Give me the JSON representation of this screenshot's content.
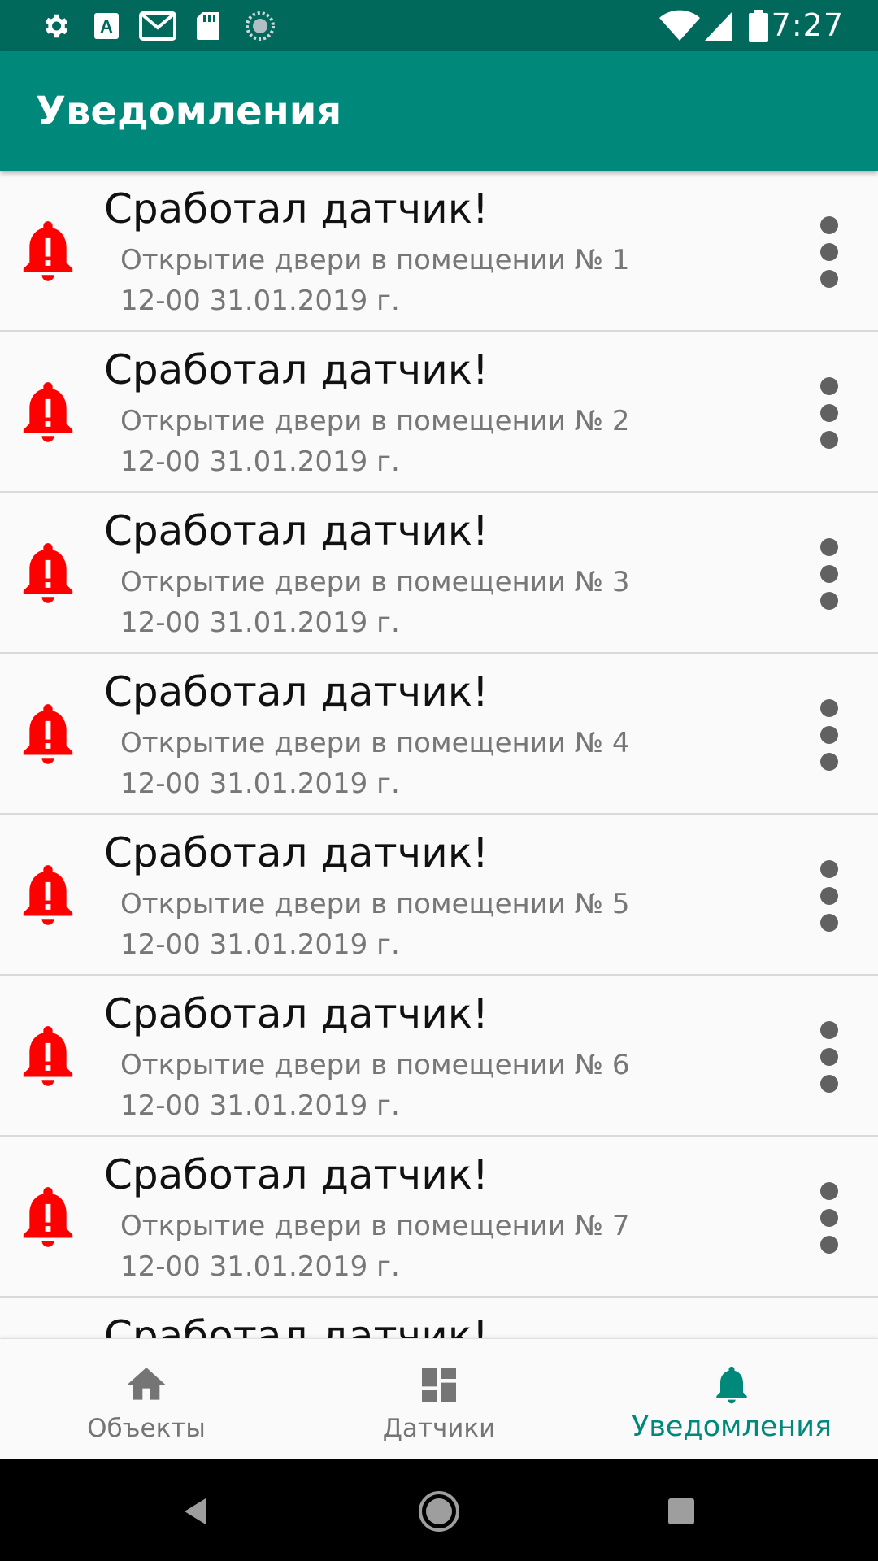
{
  "status_bar": {
    "time": "7:27",
    "left_icons": [
      "gear-icon",
      "a-box-icon",
      "gmail-icon",
      "sd-card-icon",
      "sync-circle-icon"
    ],
    "right_icons": [
      "wifi-icon",
      "signal-icon",
      "battery-icon"
    ]
  },
  "app_bar": {
    "title": "Уведомления"
  },
  "colors": {
    "primary": "#00897b",
    "primary_dark": "#00695c",
    "alarm": "#ff0000",
    "nav_active": "#00897b",
    "nav_inactive": "#757575"
  },
  "notifications": [
    {
      "title": "Сработал датчик!",
      "description": "Открытие двери в помещении № 1",
      "time": "12-00 31.01.2019 г."
    },
    {
      "title": "Сработал датчик!",
      "description": "Открытие двери в помещении № 2",
      "time": "12-00 31.01.2019 г."
    },
    {
      "title": "Сработал датчик!",
      "description": "Открытие двери в помещении № 3",
      "time": "12-00 31.01.2019 г."
    },
    {
      "title": "Сработал датчик!",
      "description": "Открытие двери в помещении № 4",
      "time": "12-00 31.01.2019 г."
    },
    {
      "title": "Сработал датчик!",
      "description": "Открытие двери в помещении № 5",
      "time": "12-00 31.01.2019 г."
    },
    {
      "title": "Сработал датчик!",
      "description": "Открытие двери в помещении № 6",
      "time": "12-00 31.01.2019 г."
    },
    {
      "title": "Сработал датчик!",
      "description": "Открытие двери в помещении № 7",
      "time": "12-00 31.01.2019 г."
    },
    {
      "title": "Сработал датчик!",
      "description": "",
      "time": ""
    }
  ],
  "bottom_nav": {
    "items": [
      {
        "label": "Объекты",
        "icon": "home-icon",
        "active": false
      },
      {
        "label": "Датчики",
        "icon": "dashboard-icon",
        "active": false
      },
      {
        "label": "Уведомления",
        "icon": "bell-icon",
        "active": true
      }
    ]
  },
  "system_nav": {
    "buttons": [
      "back-icon",
      "home-circle-icon",
      "recents-icon"
    ]
  }
}
